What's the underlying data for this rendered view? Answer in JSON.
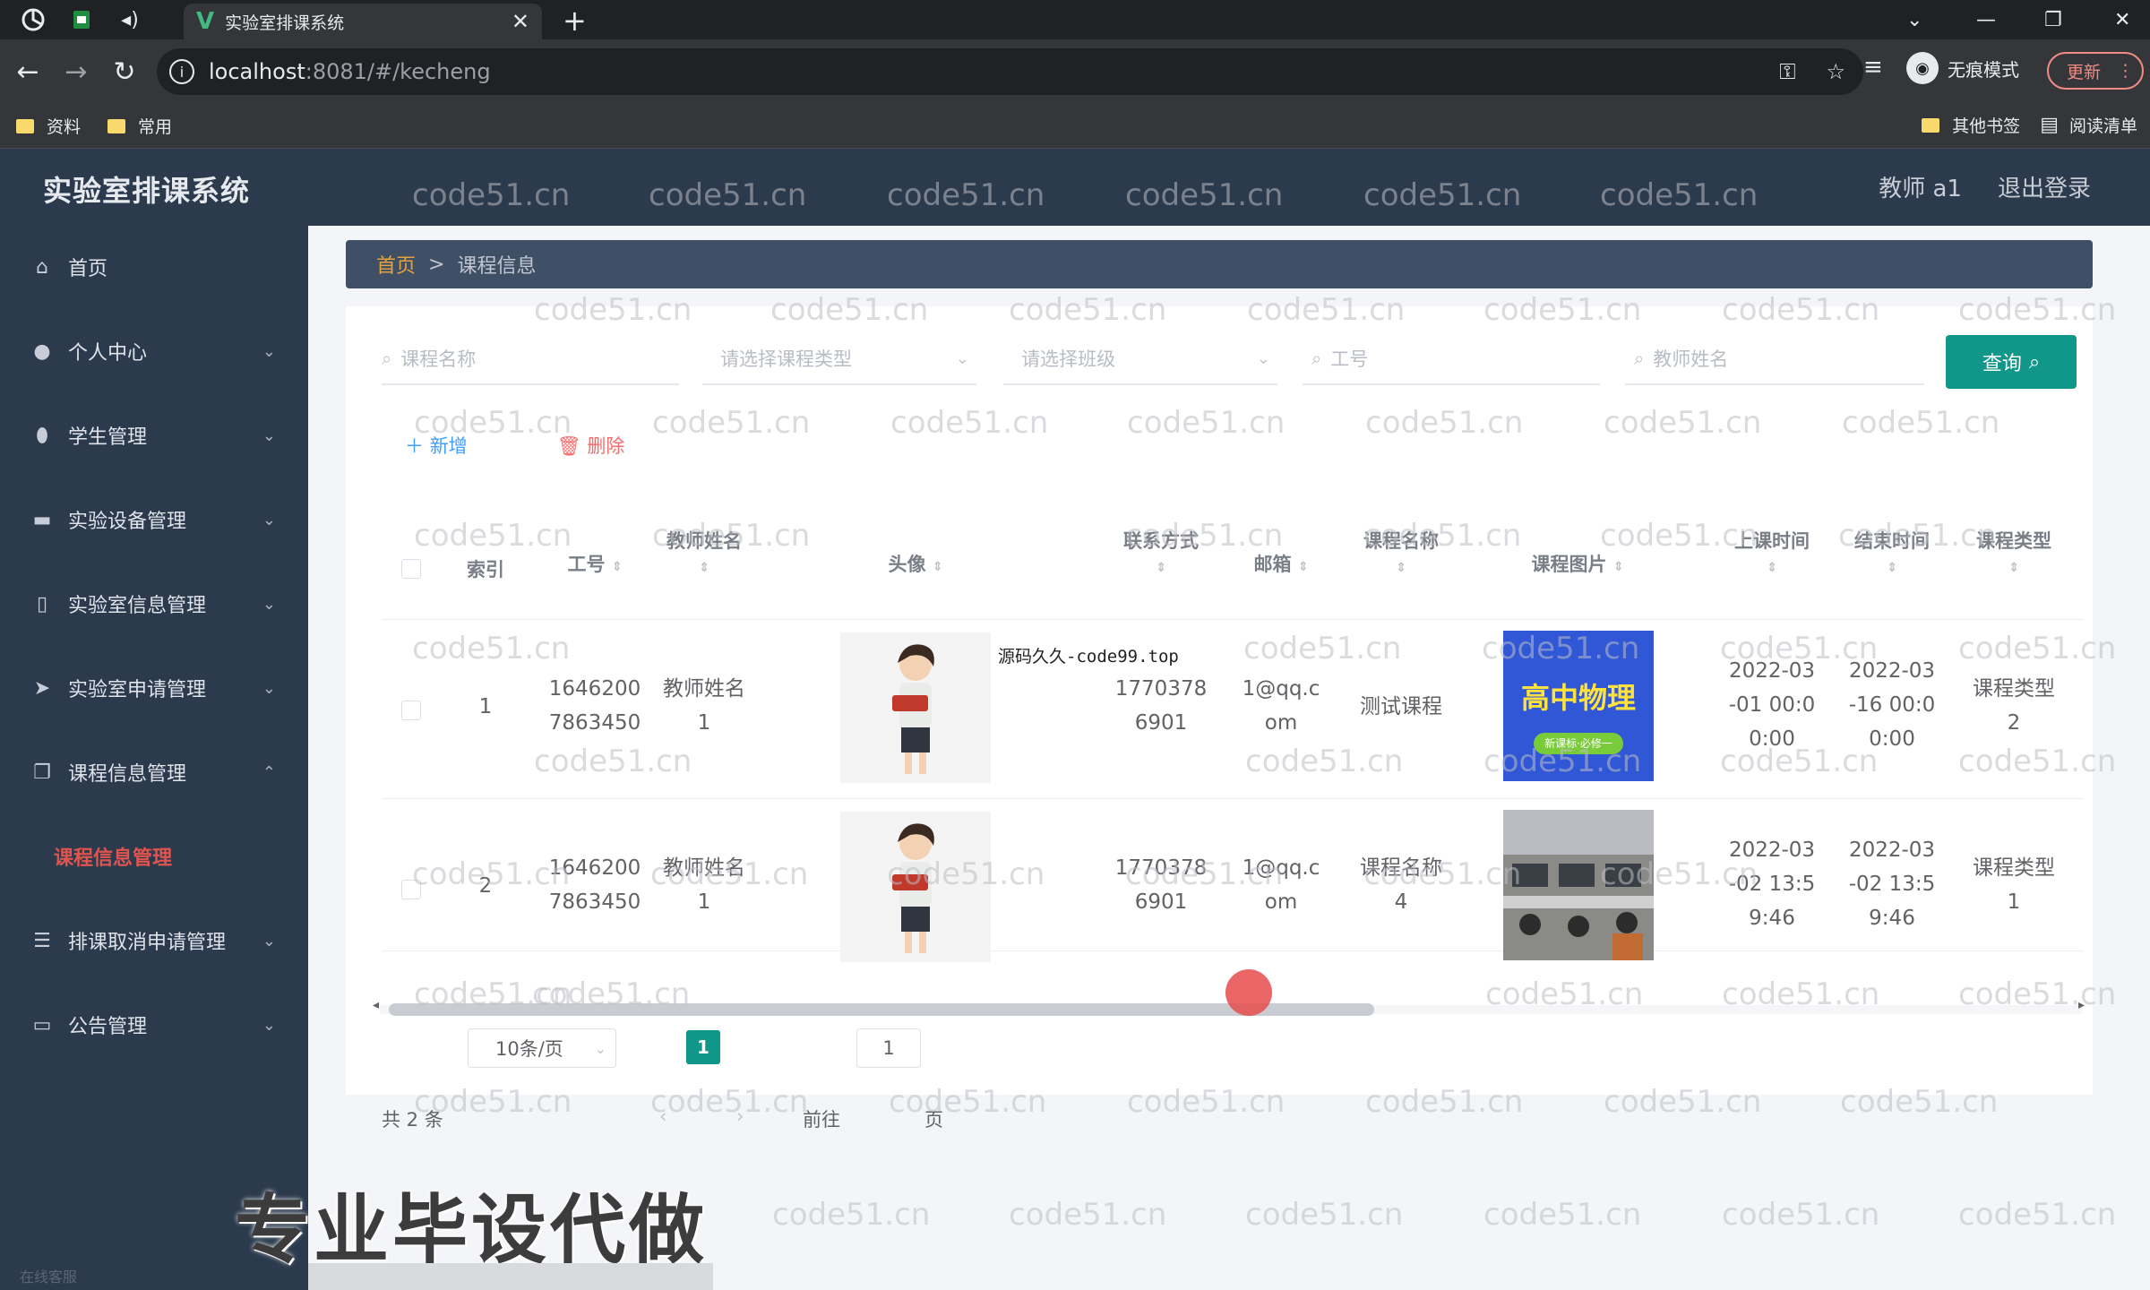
{
  "browser": {
    "tab_title": "实验室排课系统",
    "tab_logo": "V",
    "url_host": "localhost",
    "url_rest": ":8081/#/kecheng",
    "incognito_label": "无痕模式",
    "update_label": "更新",
    "bookmarks": [
      "资料",
      "常用"
    ],
    "bookmarks_right": [
      "其他书签",
      "阅读清单"
    ]
  },
  "header": {
    "app_title": "实验室排课系统",
    "user": "教师 a1",
    "logout": "退出登录"
  },
  "sidebar": {
    "items": [
      {
        "label": "首页",
        "icon": "home-icon"
      },
      {
        "label": "个人中心",
        "icon": "user-icon"
      },
      {
        "label": "学生管理",
        "icon": "location-icon"
      },
      {
        "label": "实验设备管理",
        "icon": "briefcase-icon"
      },
      {
        "label": "实验室信息管理",
        "icon": "phone-icon"
      },
      {
        "label": "实验室申请管理",
        "icon": "send-icon"
      },
      {
        "label": "课程信息管理",
        "icon": "copy-icon"
      },
      {
        "label": "排课取消申请管理",
        "icon": "sliders-icon"
      },
      {
        "label": "公告管理",
        "icon": "message-icon"
      }
    ],
    "active_sub": "课程信息管理",
    "foot": "在线客服"
  },
  "breadcrumb": {
    "home": "首页",
    "sep": ">",
    "current": "课程信息"
  },
  "filters": {
    "course_name": "课程名称",
    "course_type": "请选择课程类型",
    "class": "请选择班级",
    "job_no": "工号",
    "teacher_name": "教师姓名",
    "query": "查询"
  },
  "actions": {
    "add": "新增",
    "delete": "删除"
  },
  "table": {
    "headers": {
      "index": "索引",
      "job_no": "工号",
      "teacher_name": "教师姓名",
      "avatar": "头像",
      "contact": "联系方式",
      "email": "邮箱",
      "course_name": "课程名称",
      "course_image": "课程图片",
      "start_time": "上课时间",
      "end_time": "结束时间",
      "course_type": "课程类型"
    },
    "rows": [
      {
        "index": "1",
        "job_no": [
          "1646200",
          "7863450"
        ],
        "teacher_name": [
          "教师姓名",
          "1"
        ],
        "contact": [
          "1770378",
          "6901"
        ],
        "email": [
          "1@qq.c",
          "om"
        ],
        "course_name": [
          "测试课程"
        ],
        "course_image": {
          "title": "高中物理",
          "sub": "新课标·必修一"
        },
        "start_time": [
          "2022-03",
          "-01 00:0",
          "0:00"
        ],
        "end_time": [
          "2022-03",
          "-16 00:0",
          "0:00"
        ],
        "course_type": [
          "课程类型",
          "2"
        ]
      },
      {
        "index": "2",
        "job_no": [
          "1646200",
          "7863450"
        ],
        "teacher_name": [
          "教师姓名",
          "1"
        ],
        "contact": [
          "1770378",
          "6901"
        ],
        "email": [
          "1@qq.c",
          "om"
        ],
        "course_name": [
          "课程名称",
          "4"
        ],
        "course_image": {
          "title": "",
          "sub": ""
        },
        "start_time": [
          "2022-03",
          "-02 13:5",
          "9:46"
        ],
        "end_time": [
          "2022-03",
          "-02 13:5",
          "9:46"
        ],
        "course_type": [
          "课程类型",
          "1"
        ]
      }
    ]
  },
  "pagination": {
    "total": "共 2 条",
    "page_size": "10条/页",
    "current": "1",
    "goto_prefix": "前往",
    "goto_value": "1",
    "goto_suffix": "页"
  },
  "overlays": {
    "note": "源码久久-code99.top",
    "promo": "专业毕设代做",
    "watermark": "code51.cn"
  },
  "colors": {
    "accent": "#11968a",
    "sidebar_bg": "#2b3a4d",
    "active_menu": "#e0544e",
    "danger": "#f56c6c",
    "primary": "#409eff"
  }
}
